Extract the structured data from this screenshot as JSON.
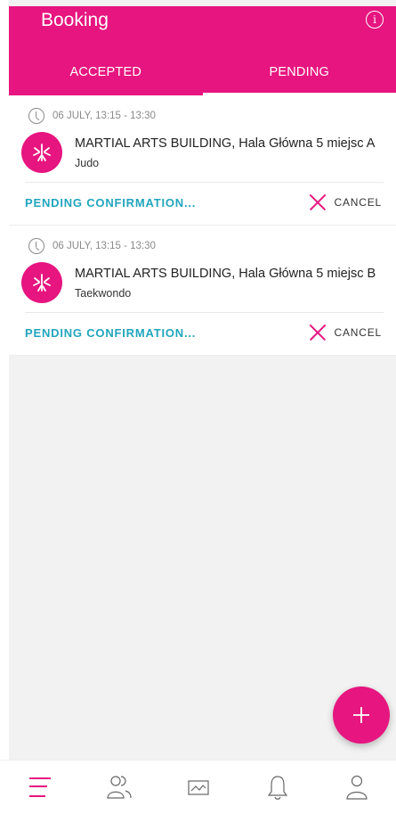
{
  "header": {
    "title": "Booking",
    "info_icon": "info-icon",
    "info_glyph": "i"
  },
  "tabs": [
    {
      "label": "ACCEPTED",
      "active": false
    },
    {
      "label": "PENDING",
      "active": true
    }
  ],
  "bookings": [
    {
      "time": "06 JULY, 13:15 - 13:30",
      "venue": "MARTIAL ARTS BUILDING, Hala Główna 5 miejsc A",
      "activity": "Judo",
      "status": "PENDING CONFIRMATION...",
      "cancel_label": "CANCEL"
    },
    {
      "time": "06 JULY, 13:15 - 13:30",
      "venue": "MARTIAL ARTS BUILDING, Hala Główna 5 miejsc B",
      "activity": "Taekwondo",
      "status": "PENDING CONFIRMATION...",
      "cancel_label": "CANCEL"
    }
  ],
  "fab": {
    "icon": "plus-icon"
  },
  "bottom_nav": [
    {
      "icon": "menu-icon",
      "active": true
    },
    {
      "icon": "people-icon",
      "active": false
    },
    {
      "icon": "image-icon",
      "active": false
    },
    {
      "icon": "bell-icon",
      "active": false
    },
    {
      "icon": "profile-icon",
      "active": false
    }
  ],
  "colors": {
    "brand": "#e6157f",
    "status": "#21a5bd",
    "muted": "#8a8a8a",
    "background": "#f2f2f2"
  }
}
